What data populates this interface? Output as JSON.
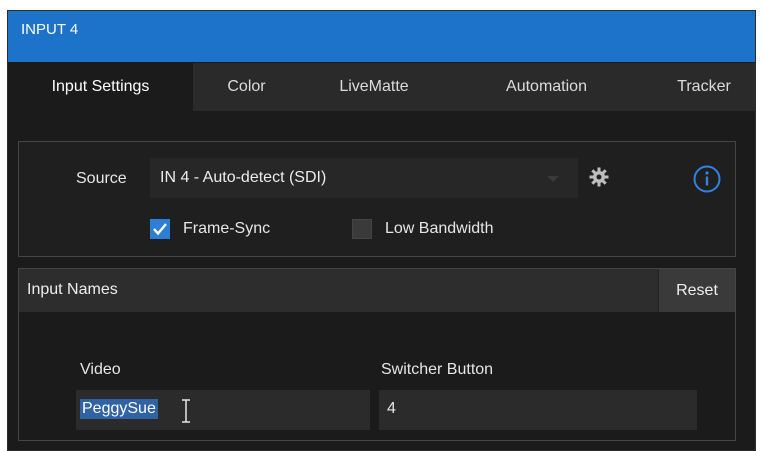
{
  "window": {
    "title": "INPUT 4"
  },
  "tabs": [
    "Input Settings",
    "Color",
    "LiveMatte",
    "Automation",
    "Tracker"
  ],
  "active_tab": "Input Settings",
  "source": {
    "label": "Source",
    "value": "IN 4 - Auto-detect (SDI)",
    "icons": [
      "chevron-down-icon",
      "gear-icon",
      "info-icon"
    ]
  },
  "checkboxes": [
    {
      "label": "Frame-Sync",
      "checked": true
    },
    {
      "label": "Low Bandwidth",
      "checked": false
    }
  ],
  "input_names": {
    "title": "Input Names",
    "reset_label": "Reset",
    "video_label": "Video",
    "video_value": "PeggySue",
    "switcher_label": "Switcher Button",
    "switcher_value": "4"
  },
  "colors": {
    "accent": "#1d72c9",
    "selection": "#2f63a6",
    "checkbox": "#2d7fd6"
  }
}
